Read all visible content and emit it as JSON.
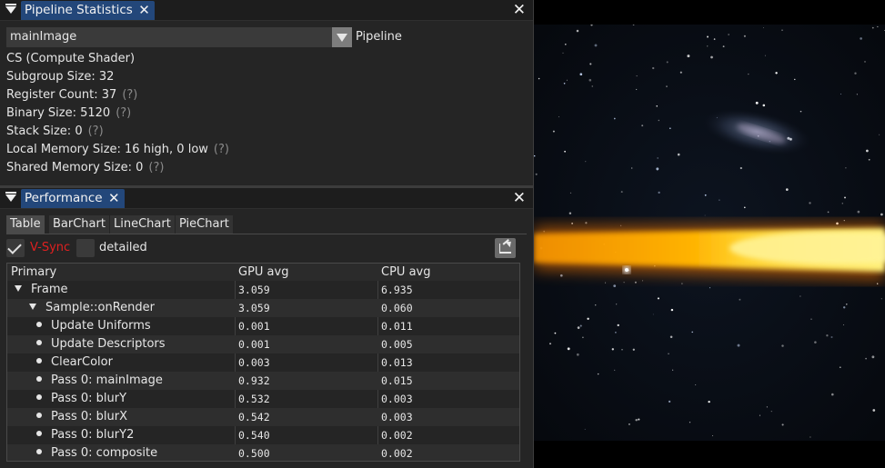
{
  "pipeline_panel": {
    "tab_title": "Pipeline Statistics",
    "close_glyph": "✕",
    "selected_shader": "mainImage",
    "combo_label": "Pipeline",
    "stats": [
      {
        "text": "CS (Compute Shader)",
        "help": ""
      },
      {
        "text": "Subgroup Size: 32",
        "help": ""
      },
      {
        "text": "Register Count: 37",
        "help": "(?)"
      },
      {
        "text": "Binary Size: 5120",
        "help": "(?)"
      },
      {
        "text": "Stack Size: 0",
        "help": "(?)"
      },
      {
        "text": "Local Memory Size: 16 high, 0 low",
        "help": "(?)"
      },
      {
        "text": "Shared Memory Size: 0",
        "help": "(?)"
      }
    ]
  },
  "performance_panel": {
    "tab_title": "Performance",
    "close_glyph": "✕",
    "tabs": [
      "Table",
      "BarChart",
      "LineChart",
      "PieChart"
    ],
    "active_tab": "Table",
    "vsync_label": "V-Sync",
    "vsync_checked": true,
    "detailed_label": "detailed",
    "detailed_checked": false,
    "table": {
      "headers": [
        "Primary",
        "GPU avg",
        "CPU avg"
      ],
      "rows": [
        {
          "name": "Frame",
          "gpu": "3.059",
          "cpu": "6.935",
          "level": 0,
          "marker": "expanded"
        },
        {
          "name": "Sample::onRender",
          "gpu": "3.059",
          "cpu": "0.060",
          "level": 1,
          "marker": "expanded"
        },
        {
          "name": "Update Uniforms",
          "gpu": "0.001",
          "cpu": "0.011",
          "level": 2,
          "marker": "leaf"
        },
        {
          "name": "Update Descriptors",
          "gpu": "0.001",
          "cpu": "0.005",
          "level": 2,
          "marker": "leaf"
        },
        {
          "name": "ClearColor",
          "gpu": "0.003",
          "cpu": "0.013",
          "level": 2,
          "marker": "leaf"
        },
        {
          "name": "Pass 0: mainImage",
          "gpu": "0.932",
          "cpu": "0.015",
          "level": 2,
          "marker": "leaf"
        },
        {
          "name": "Pass 0: blurY",
          "gpu": "0.532",
          "cpu": "0.003",
          "level": 2,
          "marker": "leaf"
        },
        {
          "name": "Pass 0: blurX",
          "gpu": "0.542",
          "cpu": "0.003",
          "level": 2,
          "marker": "leaf"
        },
        {
          "name": "Pass 0: blurY2",
          "gpu": "0.540",
          "cpu": "0.002",
          "level": 2,
          "marker": "leaf"
        },
        {
          "name": "Pass 0: composite",
          "gpu": "0.500",
          "cpu": "0.002",
          "level": 2,
          "marker": "leaf"
        }
      ]
    }
  },
  "colors": {
    "tab_active": "#23477a",
    "vsync_text": "#e02020",
    "panel_bg": "#252525",
    "viewport_bg": "#000000",
    "beam_core": "#ffe27a",
    "beam_outer": "#ff8c00"
  },
  "icons": {
    "panel_menu": "triangle-down-icon",
    "combo_dropdown": "chevron-down-icon",
    "export": "export-icon"
  }
}
